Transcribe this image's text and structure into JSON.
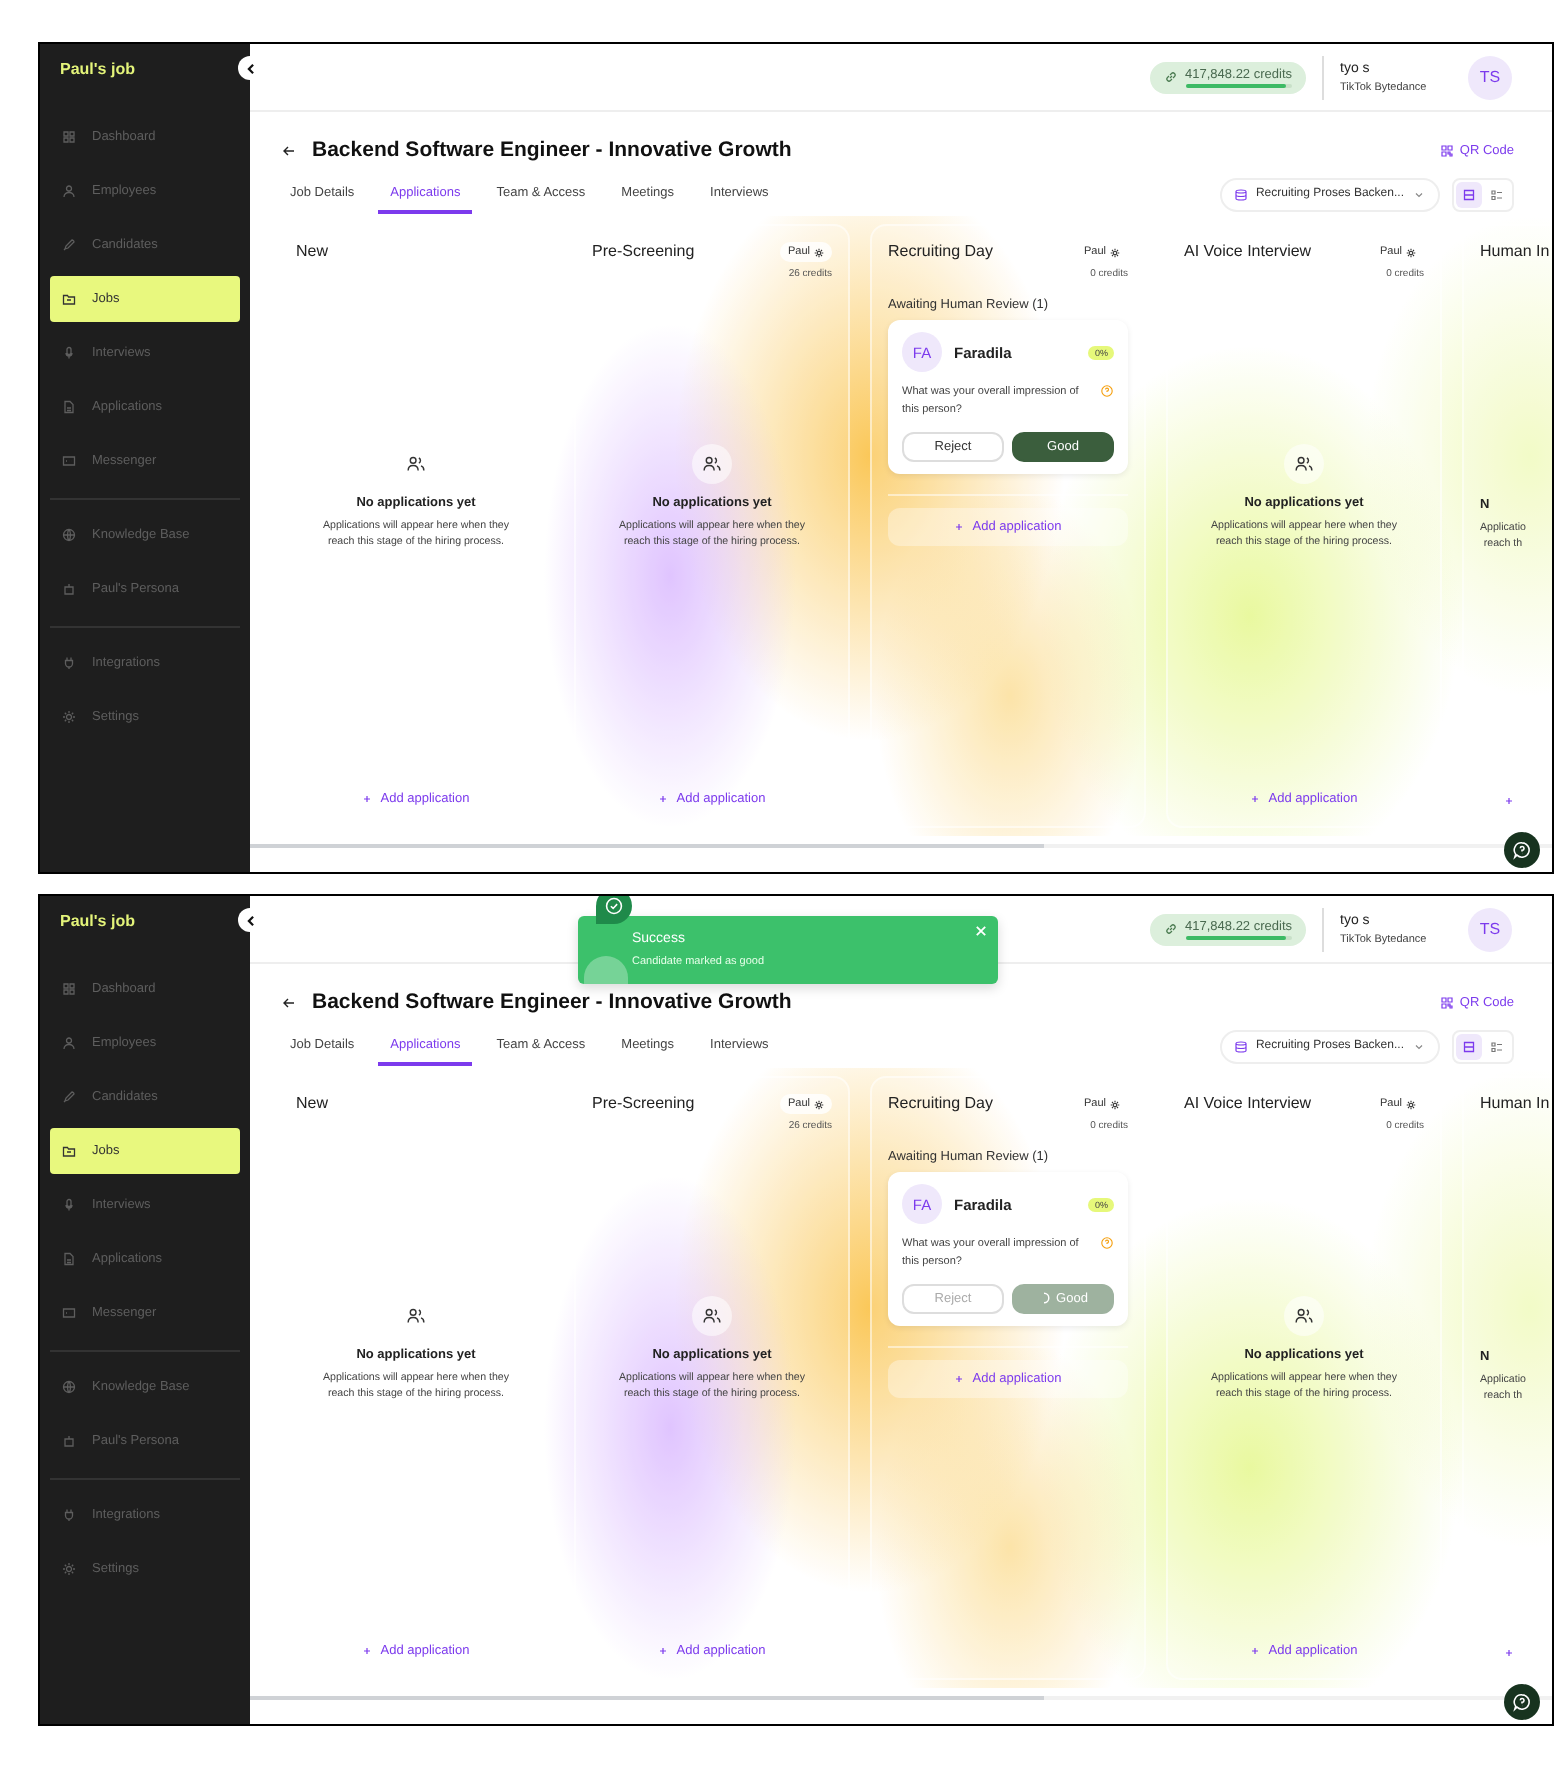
{
  "frames": [
    {
      "sidebar": {
        "brand": "Paul's job",
        "sections": [
          [
            {
              "label": "Dashboard",
              "selected": false
            },
            {
              "label": "Employees",
              "selected": false
            },
            {
              "label": "Candidates",
              "selected": false
            },
            {
              "label": "Jobs",
              "selected": true
            },
            {
              "label": "Interviews",
              "selected": false
            },
            {
              "label": "Applications",
              "selected": false
            },
            {
              "label": "Messenger",
              "selected": false
            }
          ],
          [
            {
              "label": "Knowledge Base",
              "selected": false
            },
            {
              "label": "Paul's Persona",
              "selected": false
            }
          ],
          [
            {
              "label": "Integrations",
              "selected": false
            },
            {
              "label": "Settings",
              "selected": false
            }
          ]
        ]
      },
      "header": {
        "credits": "417,848.22 credits",
        "level": 0.95,
        "user_name": "tyo s",
        "org": "TikTok Bytedance",
        "initials": "TS"
      },
      "job": {
        "title": "Backend Software Engineer - Innovative Growth",
        "qr": "QR Code",
        "tabs": [
          {
            "label": "Job Details",
            "selected": false
          },
          {
            "label": "Applications",
            "selected": true
          },
          {
            "label": "Team & Access",
            "selected": false
          },
          {
            "label": "Meetings",
            "selected": false
          },
          {
            "label": "Interviews",
            "selected": false
          }
        ],
        "pipeline": "Recruiting Proses Backen..."
      },
      "columns": [
        {
          "kind": "empty",
          "title": "New",
          "empty_title": "No applications yet",
          "empty_lines": [
            "Applications will appear here when they",
            "reach this stage of the hiring process."
          ],
          "add_label": "Add application"
        },
        {
          "kind": "empty",
          "title": "Pre-Screening",
          "agent": "Paul",
          "credits": "26 credits",
          "empty_title": "No applications yet",
          "empty_lines": [
            "Applications will appear here when they",
            "reach this stage of the hiring process."
          ],
          "add_label": "Add application"
        },
        {
          "kind": "review",
          "title": "Recruiting Day",
          "agent": "Paul",
          "credits": "0 credits",
          "group_title": "Awaiting Human Review (1)",
          "card": {
            "initials": "FA",
            "name": "Faradila",
            "score": "0%",
            "question": "What was your overall impression of this person?",
            "reject": "Reject",
            "good": "Good",
            "loading": false
          },
          "add_label": "Add application"
        },
        {
          "kind": "empty",
          "title": "AI Voice Interview",
          "agent": "Paul",
          "credits": "0 credits",
          "empty_title": "No applications yet",
          "empty_lines": [
            "Applications will appear here when they",
            "reach this stage of the hiring process."
          ],
          "add_label": "Add application"
        },
        {
          "kind": "empty",
          "title": "Human In",
          "empty_title": "N",
          "empty_lines": [
            "Applicatio",
            "reach th"
          ]
        }
      ]
    },
    {
      "sidebar": {
        "brand": "Paul's job",
        "sections": [
          [
            {
              "label": "Dashboard",
              "selected": false
            },
            {
              "label": "Employees",
              "selected": false
            },
            {
              "label": "Candidates",
              "selected": false
            },
            {
              "label": "Jobs",
              "selected": true
            },
            {
              "label": "Interviews",
              "selected": false
            },
            {
              "label": "Applications",
              "selected": false
            },
            {
              "label": "Messenger",
              "selected": false
            }
          ],
          [
            {
              "label": "Knowledge Base",
              "selected": false
            },
            {
              "label": "Paul's Persona",
              "selected": false
            }
          ],
          [
            {
              "label": "Integrations",
              "selected": false
            },
            {
              "label": "Settings",
              "selected": false
            }
          ]
        ]
      },
      "header": {
        "credits": "417,848.22 credits",
        "level": 0.95,
        "user_name": "tyo s",
        "org": "TikTok Bytedance",
        "initials": "TS"
      },
      "job": {
        "title": "Backend Software Engineer - Innovative Growth",
        "qr": "QR Code",
        "tabs": [
          {
            "label": "Job Details",
            "selected": false
          },
          {
            "label": "Applications",
            "selected": true
          },
          {
            "label": "Team & Access",
            "selected": false
          },
          {
            "label": "Meetings",
            "selected": false
          },
          {
            "label": "Interviews",
            "selected": false
          }
        ],
        "pipeline": "Recruiting Proses Backen..."
      },
      "toast": {
        "title": "Success",
        "message": "Candidate marked as good"
      },
      "columns": [
        {
          "kind": "empty",
          "title": "New",
          "empty_title": "No applications yet",
          "empty_lines": [
            "Applications will appear here when they",
            "reach this stage of the hiring process."
          ],
          "add_label": "Add application"
        },
        {
          "kind": "empty",
          "title": "Pre-Screening",
          "agent": "Paul",
          "credits": "26 credits",
          "empty_title": "No applications yet",
          "empty_lines": [
            "Applications will appear here when they",
            "reach this stage of the hiring process."
          ],
          "add_label": "Add application"
        },
        {
          "kind": "review",
          "title": "Recruiting Day",
          "agent": "Paul",
          "credits": "0 credits",
          "group_title": "Awaiting Human Review (1)",
          "card": {
            "initials": "FA",
            "name": "Faradila",
            "score": "0%",
            "question": "What was your overall impression of this person?",
            "reject": "Reject",
            "good": "Good",
            "loading": true
          },
          "add_label": "Add application"
        },
        {
          "kind": "empty",
          "title": "AI Voice Interview",
          "agent": "Paul",
          "credits": "0 credits",
          "empty_title": "No applications yet",
          "empty_lines": [
            "Applications will appear here when they",
            "reach this stage of the hiring process."
          ],
          "add_label": "Add application"
        },
        {
          "kind": "empty",
          "title": "Human In",
          "empty_title": "N",
          "empty_lines": [
            "Applicatio",
            "reach th"
          ]
        }
      ]
    }
  ]
}
